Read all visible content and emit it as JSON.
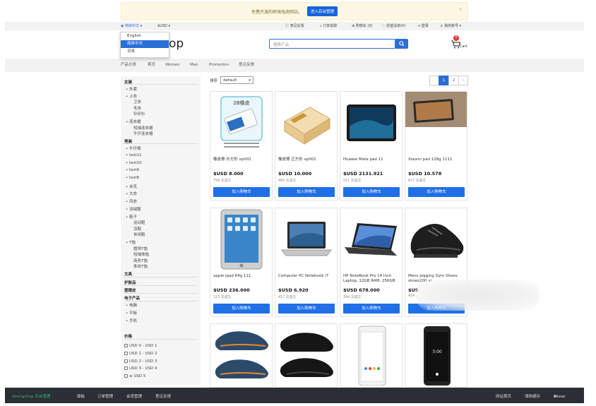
{
  "notice": {
    "text": "免费开源的跨境电商网站。",
    "button": "进入后台管理",
    "close": "×"
  },
  "topbar": {
    "language": "简体中文",
    "currency": "$USD",
    "feedback": "意见反馈",
    "order_query": "订单追踪",
    "cart": "购物车 (0)",
    "wishlist": "愿望清单(0)",
    "login": "登录",
    "account": "我的账号"
  },
  "language_menu": [
    "English",
    "简体中文",
    "日本"
  ],
  "header": {
    "logo": "op",
    "search_placeholder": "搜索产品",
    "cart_count": "0",
    "cart_label": "Cart"
  },
  "nav": [
    "产品分类",
    "首页",
    "Women",
    "Man",
    "Promotion",
    "意见反馈"
  ],
  "sidebar": {
    "cat_women": "女装",
    "women_items": [
      "外套",
      "上衣"
    ],
    "women_sub1": [
      "卫衣",
      "毛衣",
      "针织衫"
    ],
    "women_dress": "连衣裙",
    "women_sub2": [
      "短袖连衣裙",
      "牛仔连衣裙"
    ],
    "cat_men": "男装",
    "men_items": [
      "牛仔裤",
      "test11",
      "test10",
      "test9",
      "test8",
      "夹克",
      "大衣",
      "风衣",
      "羽绒服",
      "鞋子"
    ],
    "men_shoes": [
      "运动鞋",
      "凉鞋",
      "休闲鞋"
    ],
    "men_tshirt": "T恤",
    "men_tshirt_sub": [
      "圆领T恤",
      "短袖体恤",
      "商务T恤",
      "条纹T恤"
    ],
    "cat_stationery": "文具",
    "cat_skincare": "护肤品",
    "cat_bags": "壶眼皮",
    "cat_electronics": "电子产品",
    "electronics_items": [
      "电脑",
      "平板",
      "手机"
    ],
    "price_title": "价格",
    "price_ranges": [
      "USD 0 - USD 1",
      "USD 1 - USD 2",
      "USD 2 - USD 3",
      "USD 3 - USD 4",
      "≥ USD 5"
    ]
  },
  "sort": {
    "label": "排序",
    "value": "default"
  },
  "pagination": [
    "‹",
    "1",
    "2",
    "›"
  ],
  "products": [
    {
      "name": "橡皮擦 长方形 xp002",
      "price": "$USD 8.000",
      "sold": "758 次成交",
      "button": "加入购物车",
      "icon": "eraser-image",
      "tag": "2B橡皮"
    },
    {
      "name": "橡皮擦 正方形 xp001",
      "price": "$USD 10.000",
      "sold": "484 次成交",
      "button": "加入购物车",
      "icon": "eraser-box-image"
    },
    {
      "name": "Huawei Mate pad 11",
      "price": "$USD 2131.921",
      "sold": "511 次成交",
      "button": "加入购物车",
      "icon": "tablet-image"
    },
    {
      "name": "Xiaomi pad 128g 1111",
      "price": "$USD 10.578",
      "sold": "617 次成交",
      "button": "加入购物车",
      "icon": "tablet-image"
    },
    {
      "name": "apple ipad 64g 111",
      "price": "$USD 236.000",
      "sold": "523 次成交",
      "button": "加入购物车",
      "icon": "ipad-image"
    },
    {
      "name": "Computer PC Notebook i7",
      "price": "$USD 6.920",
      "sold": "417 次成交",
      "button": "加入购物车",
      "icon": "laptop-image"
    },
    {
      "name": "HP NoteBook Pro 14 Inch Laptop, 12GB RAM, 256GB",
      "price": "$USD 678.000",
      "sold": "394 次成交",
      "button": "加入购物车",
      "icon": "laptop-image"
    },
    {
      "name": "Mens Jogging Gym Shoes shoes200 xl",
      "price": "$US",
      "sold": "414",
      "button": "加入购物车",
      "icon": "shoe-image"
    },
    {
      "icon": "shoe-image"
    },
    {
      "icon": "shoe-image"
    },
    {
      "icon": "phone-image"
    },
    {
      "icon": "phone-image"
    }
  ],
  "footer": {
    "brand": "strongshop 后台管理",
    "links": [
      "面板",
      "订单管理",
      "会员管理",
      "意见反馈"
    ],
    "site": "网站首页",
    "clear": "清除缓存",
    "user": "Dkewi"
  }
}
